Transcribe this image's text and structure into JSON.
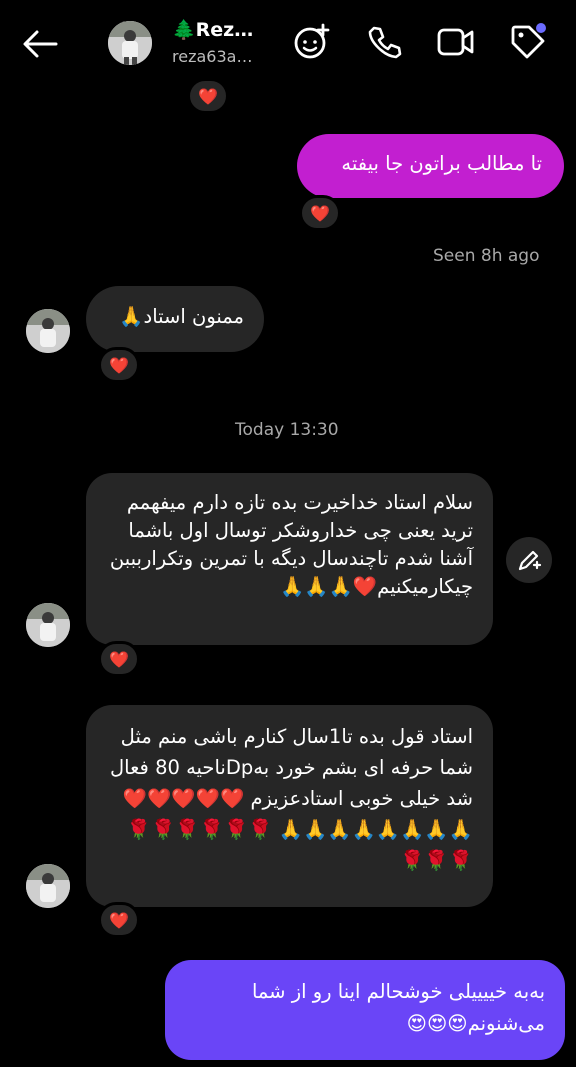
{
  "header": {
    "name": "🌲Rez…",
    "username": "reza63a…",
    "icons": {
      "back": "arrow-left-icon",
      "effects": "sparkle-face-icon",
      "call": "phone-icon",
      "video": "video-camera-icon",
      "tag": "tag-icon"
    },
    "accent": "#6b6bff"
  },
  "messages": [
    {
      "id": "m1",
      "from": "me",
      "text": "تا مطالب براتون جا بیفته",
      "reaction": "❤️",
      "color": "#c21fd0"
    },
    {
      "id": "m2",
      "from": "them",
      "text": "ممنون استاد🙏",
      "reaction": "❤️"
    },
    {
      "id": "m3",
      "from": "them",
      "text": "سلام استاد خداخیرت بده تازه دارم میفهمم ترید یعنی چی خداروشکر توسال اول باشما آشنا شدم تاچندسال دیگه با تمرین وتکراربببن چیکارمیکنیم❤️🙏🙏🙏",
      "reaction": "❤️"
    },
    {
      "id": "m4",
      "from": "them",
      "text": "استاد قول بده تا1سال کنارم باشی منم مثل شما حرفه ای بشم خورد بهDpناحیه 80 فعال شد خیلی خوبی استادعزیزم ❤️❤️❤️❤️❤️🙏🙏🙏🙏🙏🙏🙏🙏 🌹🌹🌹🌹🌹🌹🌹🌹🌹",
      "reaction": "❤️"
    },
    {
      "id": "m5",
      "from": "me",
      "text": "به‌به خییییلی خوشحالم اینا رو از شما می‌شنونم😍😍😍",
      "color": "#6a45f7"
    }
  ],
  "top_reaction": "❤️",
  "seen": "Seen 8h ago",
  "timestamp": "Today 13:30",
  "colors": {
    "heart": "#ff2a4d",
    "incoming": "#262626"
  }
}
